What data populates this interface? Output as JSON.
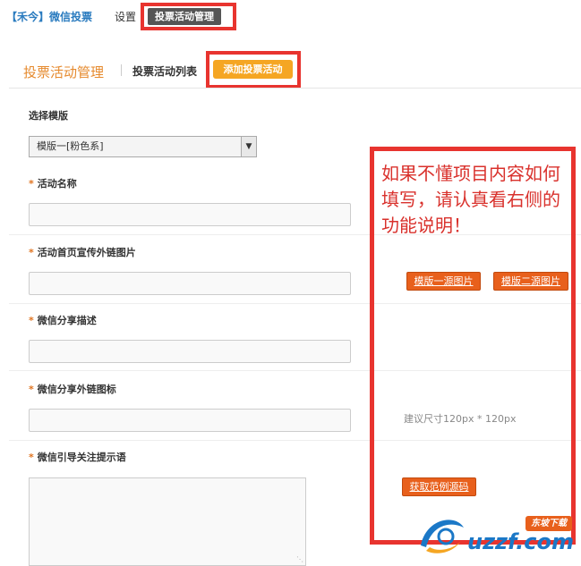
{
  "topnav": {
    "brand_bracket": "【禾今】",
    "brand_app": "微信投票",
    "settings_label": "设置",
    "active_tab_label": "投票活动管理"
  },
  "subheader": {
    "title": "投票活动管理",
    "list_label": "投票活动列表",
    "add_label": "添加投票活动"
  },
  "form": {
    "template_label": "选择模版",
    "template_value": "模版一[粉色系]",
    "fields": [
      {
        "label": "活动名称",
        "required": true,
        "value": ""
      },
      {
        "label": "活动首页宣传外链图片",
        "required": true,
        "value": ""
      },
      {
        "label": "微信分享描述",
        "required": true,
        "value": ""
      },
      {
        "label": "微信分享外链图标",
        "required": true,
        "value": ""
      },
      {
        "label": "微信引导关注提示语",
        "required": true,
        "value": ""
      }
    ],
    "required_mark": "*"
  },
  "help": {
    "note": "如果不懂项目内容如何填写，请认真看右侧的功能说明！",
    "btn_template1": "模版一源图片",
    "btn_template2": "模版二源图片",
    "size_hint": "建议尺寸120px * 120px",
    "btn_sample_code": "获取范例源码"
  },
  "watermark": {
    "badge": "东坡下载",
    "domain": "uzzf.com"
  },
  "colors": {
    "accent_orange": "#f5a623",
    "highlight_red": "#e8342f",
    "link_blue": "#2a7bbf",
    "button_orange": "#e8601c"
  }
}
